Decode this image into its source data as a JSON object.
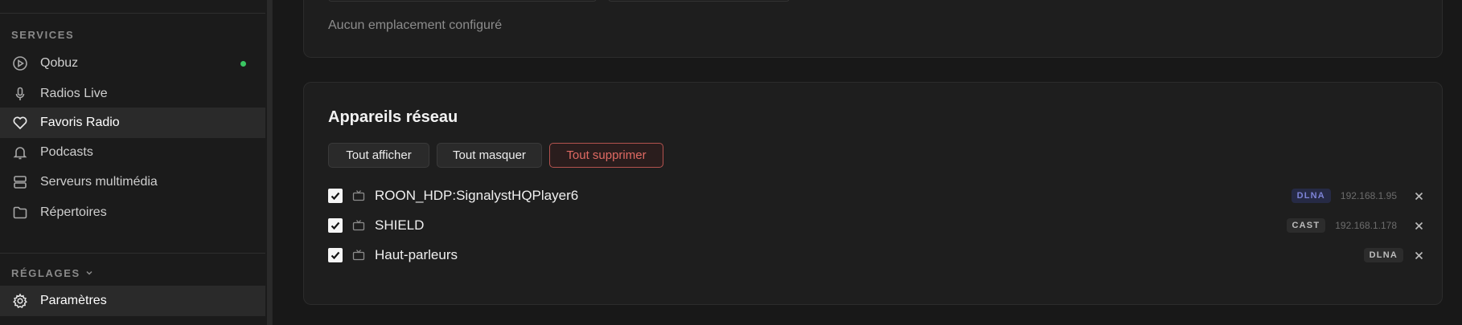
{
  "sidebar": {
    "services_label": "SERVICES",
    "items": [
      {
        "label": "Qobuz",
        "icon": "play-circle-icon",
        "status": "online"
      },
      {
        "label": "Radios Live",
        "icon": "microphone-icon"
      },
      {
        "label": "Favoris Radio",
        "icon": "heart-icon",
        "active": true
      },
      {
        "label": "Podcasts",
        "icon": "bell-icon"
      },
      {
        "label": "Serveurs multimédia",
        "icon": "server-icon"
      },
      {
        "label": "Répertoires",
        "icon": "folder-icon"
      }
    ],
    "settings_label": "RÉGLAGES",
    "settings_items": [
      {
        "label": "Paramètres",
        "icon": "gear-icon",
        "active": true
      }
    ]
  },
  "locations": {
    "empty_text": "Aucun emplacement configuré"
  },
  "devices": {
    "title": "Appareils réseau",
    "buttons": {
      "show_all": "Tout afficher",
      "hide_all": "Tout masquer",
      "delete_all": "Tout supprimer"
    },
    "list": [
      {
        "name": "ROON_HDP:SignalystHQPlayer6",
        "type": "DLNA",
        "ip": "192.168.1.95",
        "checked": true
      },
      {
        "name": "SHIELD",
        "type": "CAST",
        "ip": "192.168.1.178",
        "checked": true
      },
      {
        "name": "Haut-parleurs",
        "type": "DLNA",
        "ip": "",
        "checked": true
      }
    ]
  },
  "colors": {
    "accent_green": "#3ac662",
    "danger": "#e06a63",
    "dlna_badge": "#7d83d6"
  }
}
